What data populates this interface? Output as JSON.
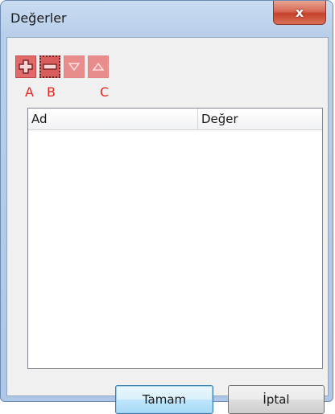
{
  "window": {
    "title": "Değerler",
    "close_label": "x"
  },
  "toolbar": {
    "buttons": [
      {
        "icon": "add-icon"
      },
      {
        "icon": "remove-icon"
      },
      {
        "icon": "move-down-icon"
      },
      {
        "icon": "move-up-icon"
      }
    ],
    "letters": [
      "A",
      "B",
      "C"
    ]
  },
  "list": {
    "columns": [
      "Ad",
      "Değer"
    ],
    "rows": []
  },
  "buttons": {
    "ok_label": "Tamam",
    "cancel_label": "İptal"
  },
  "colors": {
    "toolbar_accent": "#e06a6a",
    "annotation": "#e8261e"
  }
}
